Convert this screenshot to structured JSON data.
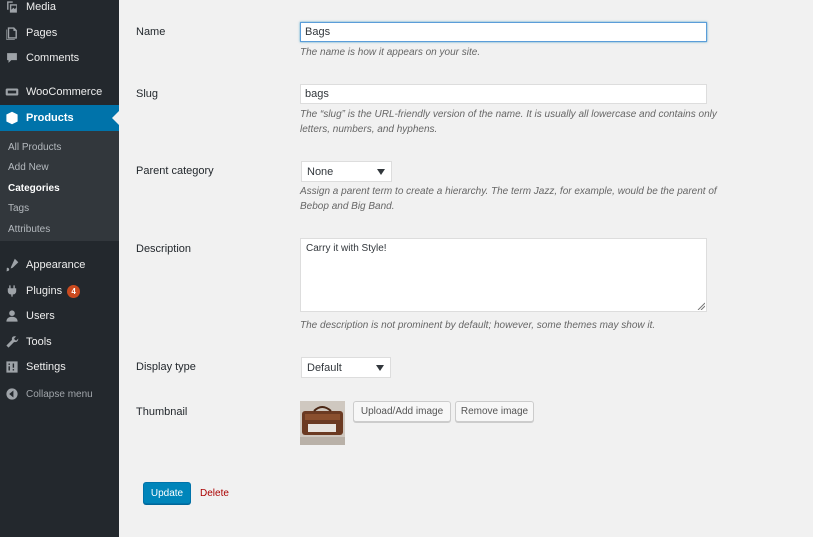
{
  "sidebar": {
    "items": [
      {
        "label": "Media",
        "icon": "media-icon"
      },
      {
        "label": "Pages",
        "icon": "pages-icon"
      },
      {
        "label": "Comments",
        "icon": "comments-icon"
      },
      {
        "label": "WooCommerce",
        "icon": "woocommerce-icon"
      },
      {
        "label": "Products",
        "icon": "products-icon",
        "active": true
      },
      {
        "label": "Appearance",
        "icon": "appearance-icon"
      },
      {
        "label": "Plugins",
        "icon": "plugins-icon",
        "badge": "4"
      },
      {
        "label": "Users",
        "icon": "users-icon"
      },
      {
        "label": "Tools",
        "icon": "tools-icon"
      },
      {
        "label": "Settings",
        "icon": "settings-icon"
      }
    ],
    "submenu": [
      "All Products",
      "Add New",
      "Categories",
      "Tags",
      "Attributes"
    ],
    "submenu_current": "Categories",
    "collapse_label": "Collapse menu"
  },
  "form": {
    "name": {
      "label": "Name",
      "value": "Bags",
      "description": "The name is how it appears on your site."
    },
    "slug": {
      "label": "Slug",
      "value": "bags",
      "description_line1": "The “slug” is the URL-friendly version of the name. It is usually all lowercase and contains only",
      "description_line2": "letters, numbers, and hyphens."
    },
    "parent": {
      "label": "Parent category",
      "selected": "None",
      "description_line1": "Assign a parent term to create a hierarchy. The term Jazz, for example, would be the parent of",
      "description_line2": "Bebop and Big Band."
    },
    "description": {
      "label": "Description",
      "value": "Carry it with Style!",
      "description": "The description is not prominent by default; however, some themes may show it."
    },
    "display_type": {
      "label": "Display type",
      "selected": "Default"
    },
    "thumbnail": {
      "label": "Thumbnail",
      "upload_label": "Upload/Add image",
      "remove_label": "Remove image"
    },
    "update_label": "Update",
    "delete_label": "Delete"
  },
  "colors": {
    "sidebar_bg": "#23282d",
    "submenu_bg": "#32373c",
    "accent": "#0073aa",
    "primary_button": "#0085ba",
    "delete": "#aa0000",
    "badge": "#ca4a1f"
  }
}
